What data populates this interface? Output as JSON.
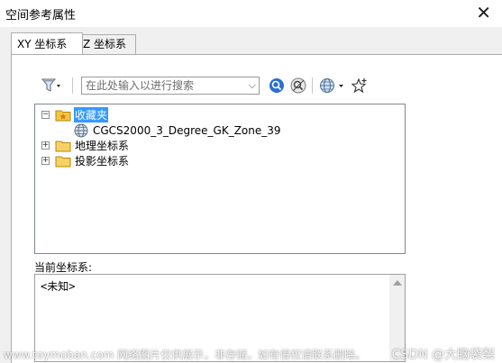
{
  "window": {
    "title": "空间参考属性",
    "close_glyph": "✕"
  },
  "tabs": [
    {
      "label": "XY 坐标系",
      "active": true
    },
    {
      "label": "Z 坐标系",
      "active": false
    }
  ],
  "toolbar": {
    "filter_icon": "filter-icon",
    "search_placeholder": "在此处输入以进行搜索",
    "search_value": "",
    "search_button_icon": "search-icon",
    "clear_search_icon": "clear-search-icon",
    "globe_icon": "globe-icon",
    "favorite_icon": "add-favorite-icon"
  },
  "tree": {
    "nodes": [
      {
        "label": "收藏夹",
        "expander": "⊟",
        "icon": "favorites-folder-icon",
        "selected": true
      },
      {
        "label": "CGCS2000_3_Degree_GK_Zone_39",
        "icon": "coordinate-system-icon"
      },
      {
        "label": "地理坐标系",
        "expander": "⊞",
        "icon": "folder-icon"
      },
      {
        "label": "投影坐标系",
        "expander": "⊞",
        "icon": "folder-icon"
      }
    ]
  },
  "current": {
    "label": "当前坐标系:",
    "value": "<未知>"
  },
  "watermark": {
    "left": "www.toymoban.com 网络图片仅供展示，非存储，如有侵权请联系删除。",
    "right": "CSDN @大脑袋梨"
  },
  "colors": {
    "selection": "#3399ff",
    "folder": "#f4c542",
    "background": "#f0f0f0"
  }
}
